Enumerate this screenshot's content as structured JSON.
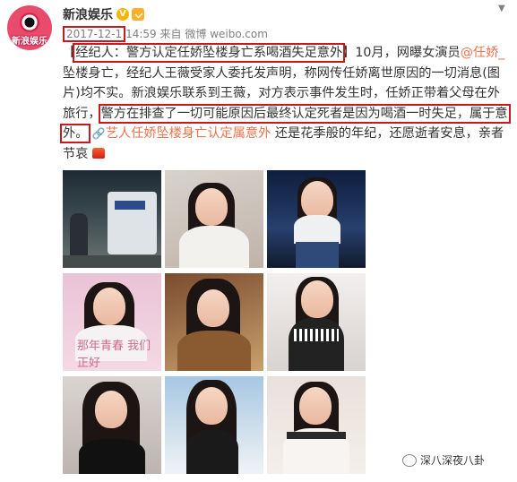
{
  "account": {
    "name": "新浪娱乐",
    "avatar_text": "新浪娱乐",
    "verified_icon": "v-badge-icon",
    "vip_icon": "vip-icon"
  },
  "meta": {
    "date": "2017-12-1",
    "time": "14:59",
    "source_prefix": "来自",
    "source": "微博 weibo.com"
  },
  "post": {
    "part1": "【",
    "hl1": "经纪人：警方认定任娇坠楼身亡系喝酒失足意外",
    "part2": "】10月，网曝女演员",
    "mention": "@任娇_",
    "part3": "坠楼身亡，经纪人王薇受家人委托发声明，称网传任娇离世原因的一切消息(图片)均不实。新浪娱乐联系到王薇，对方表示事件发生时，任娇正带着父母在外旅行，",
    "hl2": "警方在排查了一切可能原因后最终认定死者是因为喝酒一时失足，属于意外。",
    "link_text": "艺人任娇坠楼身亡认定属意外",
    "part4": "还是花季般的年纪，还愿逝者安息，亲者节哀"
  },
  "photos": [
    {
      "label": "",
      "scene": "vehicle-night"
    },
    {
      "label": "",
      "scene": "portrait-white"
    },
    {
      "label": "",
      "scene": "night-street"
    },
    {
      "label": "那年青春 我们正好",
      "scene": "magazine-pink"
    },
    {
      "label": "",
      "scene": "portrait-costume"
    },
    {
      "label": "",
      "scene": "portrait-lace"
    },
    {
      "label": "",
      "scene": "portrait-dark"
    },
    {
      "label": "",
      "scene": "portrait-beach"
    },
    {
      "label": "",
      "scene": "portrait-chair"
    }
  ],
  "watermark": {
    "icon": "wechat-icon",
    "text": "深八深夜八卦"
  },
  "colors": {
    "link": "#eb7350",
    "highlight_box": "#c8191c",
    "text": "#333333",
    "meta": "#808080"
  }
}
